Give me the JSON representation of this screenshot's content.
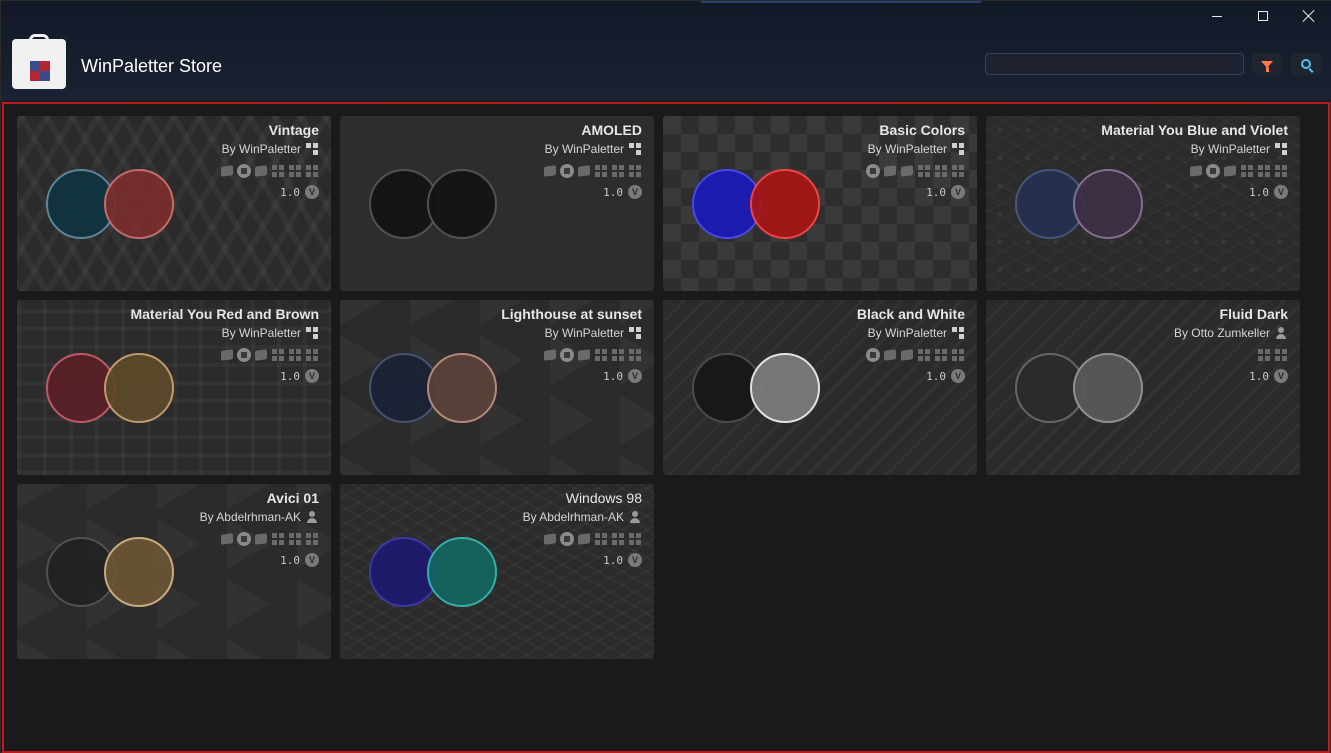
{
  "app": {
    "title": "WinPaletter Store"
  },
  "window_controls": [
    "minimize",
    "maximize",
    "close"
  ],
  "search": {
    "value": "",
    "placeholder": ""
  },
  "colors": {
    "filter_accent": "#ff7a45",
    "search_accent": "#47c7f2",
    "selection_border": "#c11a1a"
  },
  "themes": [
    {
      "title": "Vintage",
      "author": "By WinPaletter",
      "author_icon": "winpaletter-icon",
      "os_icons": [
        "xp-icon",
        "vista-icon",
        "win7-icon",
        "win8-icon",
        "win10-icon",
        "win11-icon"
      ],
      "version": "1.0",
      "circle1": {
        "fill": "#0f3340",
        "border": "#5f8ea3"
      },
      "circle2": {
        "fill": "#7a2e2e",
        "border": "#d07070"
      }
    },
    {
      "title": "AMOLED",
      "author": "By WinPaletter",
      "author_icon": "winpaletter-icon",
      "os_icons": [
        "xp-icon",
        "vista-icon",
        "win7-icon",
        "win8-icon",
        "win10-icon",
        "win11-icon"
      ],
      "version": "1.0",
      "circle1": {
        "fill": "#141414",
        "border": "#555555"
      },
      "circle2": {
        "fill": "#141414",
        "border": "#555555"
      }
    },
    {
      "title": "Basic Colors",
      "author": "By WinPaletter",
      "author_icon": "winpaletter-icon",
      "os_icons": [
        "vista-icon",
        "xp-icon",
        "win7-icon",
        "win8-icon",
        "win10-icon",
        "win11-icon"
      ],
      "version": "1.0",
      "circle1": {
        "fill": "#1a1ab8",
        "border": "#4a4aff"
      },
      "circle2": {
        "fill": "#a81616",
        "border": "#ff4545"
      }
    },
    {
      "title": "Material You Blue and Violet",
      "author": "By WinPaletter",
      "author_icon": "winpaletter-icon",
      "os_icons": [
        "xp-icon",
        "vista-icon",
        "win7-icon",
        "win8-icon",
        "win10-icon",
        "win11-icon"
      ],
      "version": "1.0",
      "circle1": {
        "fill": "#26304f",
        "border": "#4c5789"
      },
      "circle2": {
        "fill": "#3e3047",
        "border": "#8b7499"
      }
    },
    {
      "title": "Material You Red and Brown",
      "author": "By WinPaletter",
      "author_icon": "winpaletter-icon",
      "os_icons": [
        "xp-icon",
        "vista-icon",
        "win7-icon",
        "win8-icon",
        "win10-icon",
        "win11-icon"
      ],
      "version": "1.0",
      "circle1": {
        "fill": "#5b2028",
        "border": "#c9606b"
      },
      "circle2": {
        "fill": "#5e4a2b",
        "border": "#c9a670"
      }
    },
    {
      "title": "Lighthouse at sunset",
      "author": "By WinPaletter",
      "author_icon": "winpaletter-icon",
      "os_icons": [
        "xp-icon",
        "vista-icon",
        "win7-icon",
        "win8-icon",
        "win10-icon",
        "win11-icon"
      ],
      "version": "1.0",
      "circle1": {
        "fill": "#1b2236",
        "border": "#4b5578"
      },
      "circle2": {
        "fill": "#5a4239",
        "border": "#c0917e"
      }
    },
    {
      "title": "Black and White",
      "author": "By WinPaletter",
      "author_icon": "winpaletter-icon",
      "os_icons": [
        "vista-icon",
        "xp-icon",
        "win7-icon",
        "win8-icon",
        "win10-icon",
        "win11-icon"
      ],
      "version": "1.0",
      "circle1": {
        "fill": "#171717",
        "border": "#4e4e4e"
      },
      "circle2": {
        "fill": "#7d7d7d",
        "border": "#f2f2f2"
      }
    },
    {
      "title": "Fluid Dark",
      "author": "By Otto Zumkeller",
      "author_icon": "user-icon",
      "os_icons": [
        "win10-icon",
        "win11-icon"
      ],
      "version": "1.0",
      "circle1": {
        "fill": "#2b2b2b",
        "border": "#6b6b6b"
      },
      "circle2": {
        "fill": "#5a5a5a",
        "border": "#9a9a9a"
      }
    },
    {
      "title": "Avici 01",
      "author": "By Abdelrhman-AK",
      "author_icon": "user-icon",
      "os_icons": [
        "xp-icon",
        "vista-icon",
        "win7-icon",
        "win8-icon",
        "win10-icon",
        "win11-icon"
      ],
      "version": "1.0",
      "circle1": {
        "fill": "#222222",
        "border": "#555555"
      },
      "circle2": {
        "fill": "#6b5536",
        "border": "#d8b884"
      }
    },
    {
      "title": "Windows 98",
      "author": "By Abdelrhman-AK",
      "author_icon": "user-icon",
      "os_icons": [
        "xp-icon",
        "vista-icon",
        "win7-icon",
        "win8-icon",
        "win10-icon",
        "win11-icon"
      ],
      "version": "1.0",
      "title_style": "plain",
      "circle1": {
        "fill": "#1e1a70",
        "border": "#3d3ab0"
      },
      "circle2": {
        "fill": "#136660",
        "border": "#3bb8ad"
      }
    }
  ]
}
